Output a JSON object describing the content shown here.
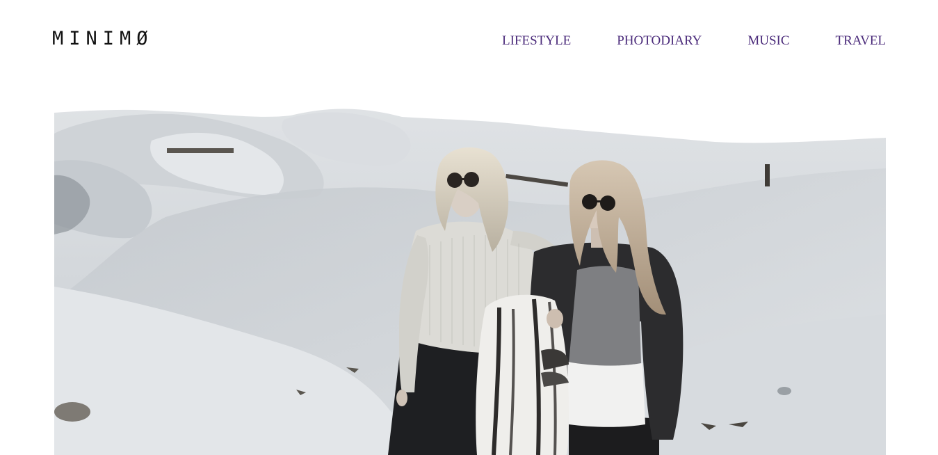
{
  "site": {
    "logo_text": "MINIMØ"
  },
  "nav": {
    "items": [
      {
        "label": "LIFESTYLE"
      },
      {
        "label": "PHOTODIARY"
      },
      {
        "label": "MUSIC"
      },
      {
        "label": "TRAVEL"
      }
    ]
  },
  "colors": {
    "nav_link": "#4a2a7a",
    "logo": "#111111",
    "background": "#ffffff"
  },
  "hero": {
    "icon": "photo-two-women-on-white-dunes"
  }
}
